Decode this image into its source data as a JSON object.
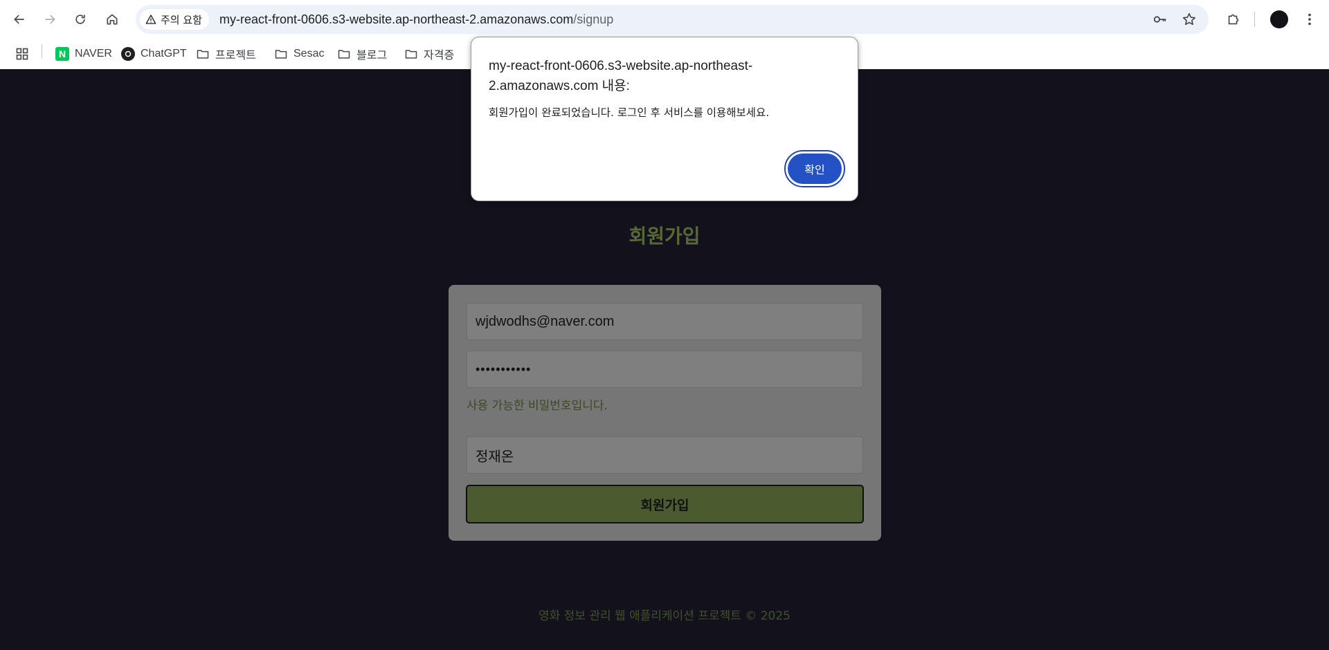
{
  "browser": {
    "security_chip": "주의 요함",
    "url_host": "my-react-front-0606.s3-website.ap-northeast-2.amazonaws.com",
    "url_path": "/signup",
    "bookmarks": [
      {
        "label": "NAVER",
        "icon": "naver-icon"
      },
      {
        "label": "ChatGPT",
        "icon": "chatgpt-icon"
      },
      {
        "label": "프로젝트",
        "icon": "folder-icon"
      },
      {
        "label": "Sesac",
        "icon": "folder-icon"
      },
      {
        "label": "블로그",
        "icon": "folder-icon"
      },
      {
        "label": "자격증",
        "icon": "folder-icon"
      }
    ]
  },
  "dialog": {
    "title": "my-react-front-0606.s3-website.ap-northeast-2.amazonaws.com 내용:",
    "message": "회원가입이 완료되었습니다. 로그인 후 서비스를 이용해보세요.",
    "ok_label": "확인"
  },
  "signup": {
    "title": "회원가입",
    "email_value": "wjdwodhs@naver.com",
    "password_value": "•••••••••••",
    "password_hint": "사용 가능한 비밀번호입니다.",
    "name_value": "정재온",
    "submit_label": "회원가입"
  },
  "footer": {
    "text": "영화 정보 관리 웹 애플리케이션 프로젝트 © 2025"
  },
  "colors": {
    "page_bg": "#13111c",
    "accent_green": "#586938",
    "dialog_button": "#2451c4"
  }
}
